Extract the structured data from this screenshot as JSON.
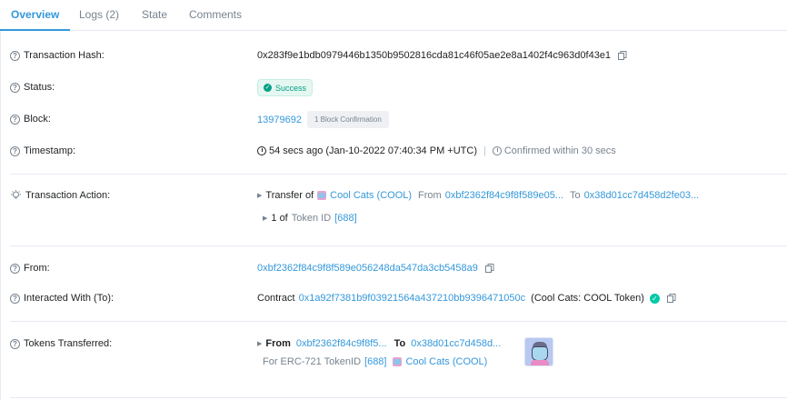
{
  "tabs": [
    {
      "label": "Overview",
      "active": true
    },
    {
      "label": "Logs (2)",
      "active": false
    },
    {
      "label": "State",
      "active": false
    },
    {
      "label": "Comments",
      "active": false
    }
  ],
  "tx": {
    "hash_label": "Transaction Hash:",
    "hash_value": "0x283f9e1bdb0979446b1350b9502816cda81c46f05ae2e8a1402f4c963d0f43e1",
    "status_label": "Status:",
    "status_value": "Success",
    "block_label": "Block:",
    "block_value": "13979692",
    "block_confirmations": "1 Block Confirmation",
    "timestamp_label": "Timestamp:",
    "timestamp_value": "54 secs ago (Jan-10-2022 07:40:34 PM +UTC)",
    "timestamp_confirmed": "Confirmed within 30 secs",
    "action_label": "Transaction Action:",
    "action": {
      "transfer_of": "Transfer of",
      "token_name": "Cool Cats (COOL)",
      "from_label": "From",
      "from_addr": "0xbf2362f84c9f8f589e05...",
      "to_label": "To",
      "to_addr": "0x38d01cc7d458d2fe03...",
      "amount_prefix": "1 of",
      "token_id_label": "Token ID",
      "token_id": "[688]"
    },
    "from_label": "From:",
    "from_value": "0xbf2362f84c9f8f589e056248da547da3cb5458a9",
    "interacted_label": "Interacted With (To):",
    "interacted_prefix": "Contract",
    "interacted_addr": "0x1a92f7381b9f03921564a437210bb9396471050c",
    "interacted_name": "(Cool Cats: COOL Token)",
    "tokens_label": "Tokens Transferred:",
    "tokens": {
      "from_label": "From",
      "from_addr": "0xbf2362f84c9f8f5...",
      "to_label": "To",
      "to_addr": "0x38d01cc7d458d...",
      "for_prefix": "For ERC-721 TokenID",
      "token_id": "[688]",
      "token_name": "Cool Cats (COOL)"
    }
  },
  "colors": {
    "link": "#3498db",
    "success": "#00a186",
    "muted": "#77838f"
  }
}
